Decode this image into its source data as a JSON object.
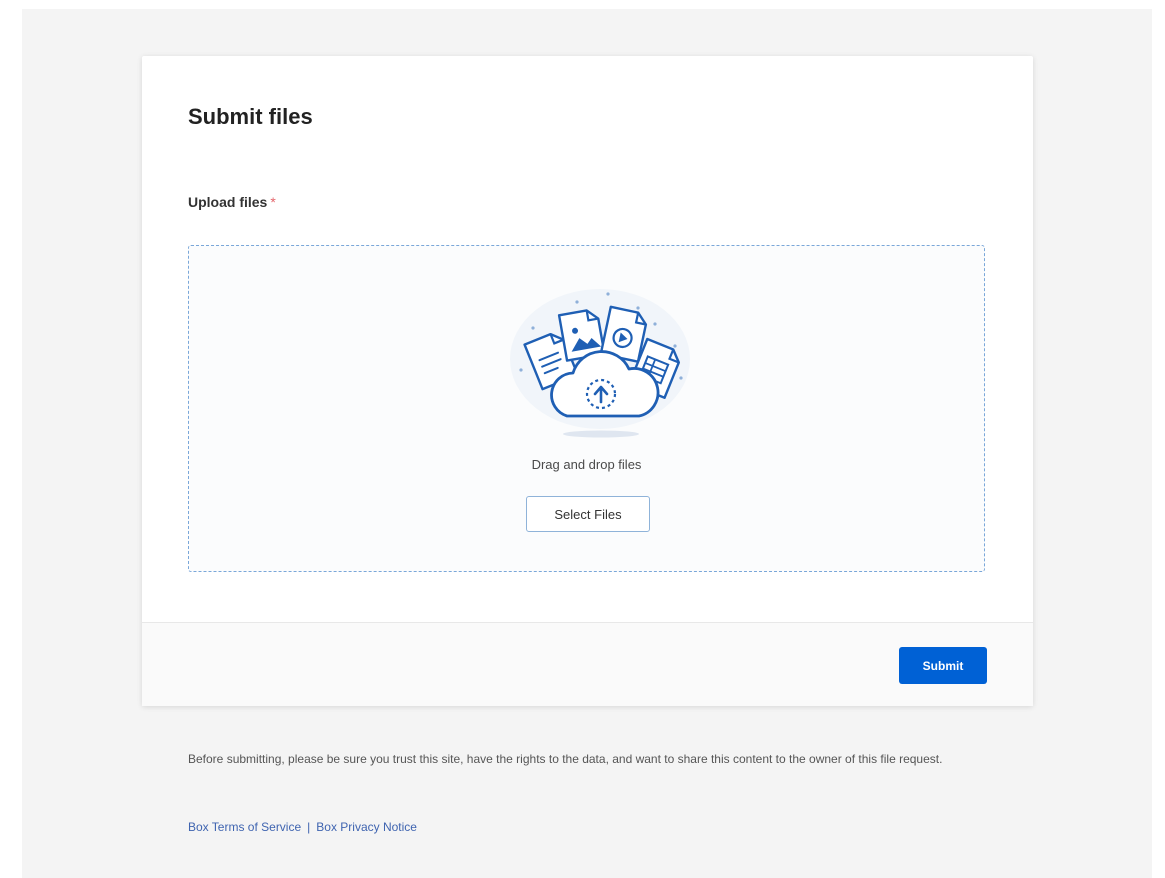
{
  "card": {
    "title": "Submit files",
    "upload_label": "Upload files",
    "required_marker": "*",
    "dropzone": {
      "text": "Drag and drop files",
      "select_button": "Select Files",
      "illustration_icon": "cloud-upload-files-icon"
    },
    "submit_button": "Submit"
  },
  "disclaimer": "Before submitting, please be sure you trust this site, have the rights to the data, and want to share this content to the owner of this file request.",
  "footer_links": {
    "terms": "Box Terms of Service",
    "separator": "|",
    "privacy": "Box Privacy Notice"
  },
  "colors": {
    "accent": "#0061d5",
    "dropzone_border": "#7aa7d9",
    "link": "#3f64b0",
    "required": "#e4656b"
  }
}
